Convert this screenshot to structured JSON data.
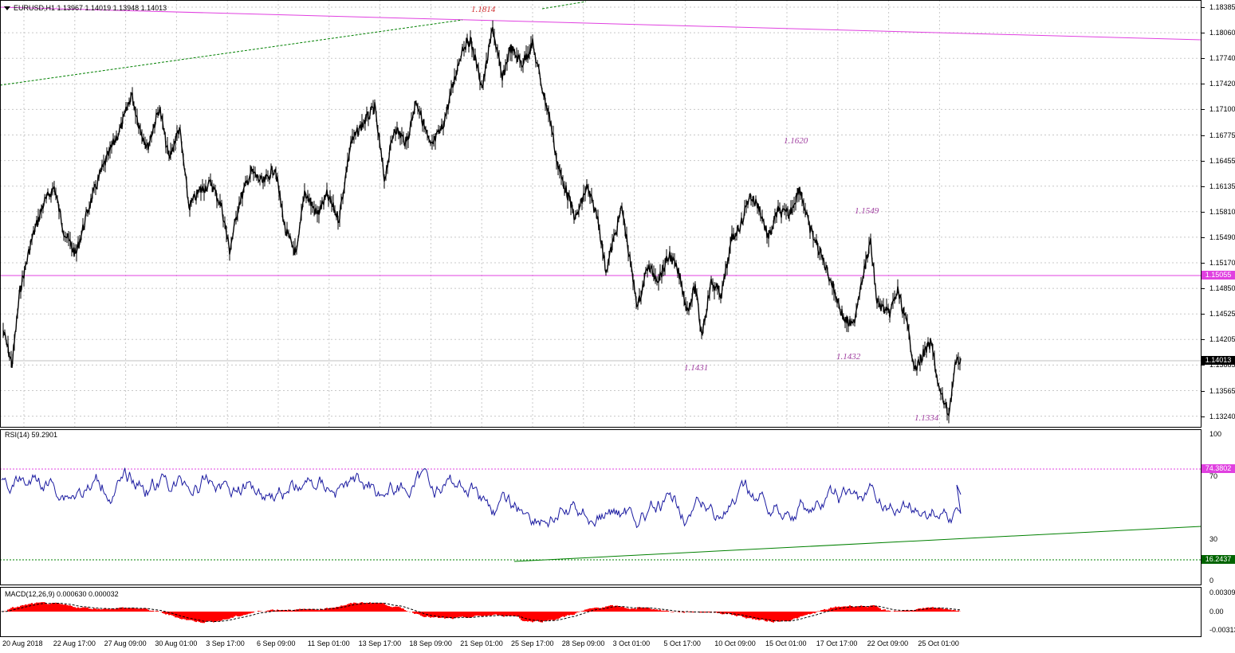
{
  "main": {
    "title": "EURUSD,H1  1.13967 1.14019 1.13948 1.14013",
    "price_labels": [
      "1.18385",
      "1.18060",
      "1.17740",
      "1.17420",
      "1.17100",
      "1.16775",
      "1.16455",
      "1.16135",
      "1.15810",
      "1.15490",
      "1.15170",
      "1.14850",
      "1.14525",
      "1.14205",
      "1.13885",
      "1.13565",
      "1.13240"
    ],
    "hline_tag": "1.15055",
    "current_tag": "1.14013",
    "annotations": {
      "peak": "1.1814",
      "a1620": "1.1620",
      "a1549": "1.1549",
      "a1431": "1.1431",
      "a1432": "1.1432",
      "a1334": "1.1334"
    },
    "colors": {
      "candles": "#000000",
      "magenta": "#e040e0",
      "trend_green": "#008000",
      "peak_red": "#d03030",
      "annotation": "#a040a0"
    }
  },
  "rsi": {
    "title": "RSI(14) 59.2901",
    "labels": [
      "100",
      "70",
      "30",
      "0"
    ],
    "tag_upper": "74.3802",
    "tag_lower": "16.2437",
    "colors": {
      "line": "#1a1aa0",
      "upper": "#e040e0",
      "lower": "#008000"
    }
  },
  "macd": {
    "title": "MACD(12,26,9) 0.000630 0.000032",
    "labels": [
      "0.003091",
      "0.00",
      "-0.003134"
    ],
    "colors": {
      "hist": "#ff0000",
      "signal": "#000000"
    }
  },
  "time_axis": [
    "20 Aug 2018",
    "22 Aug 17:00",
    "27 Aug 09:00",
    "30 Aug 01:00",
    "3 Sep 17:00",
    "6 Sep 09:00",
    "11 Sep 01:00",
    "13 Sep 17:00",
    "18 Sep 09:00",
    "21 Sep 01:00",
    "25 Sep 17:00",
    "28 Sep 09:00",
    "3 Oct 01:00",
    "5 Oct 17:00",
    "10 Oct 09:00",
    "15 Oct 01:00",
    "17 Oct 17:00",
    "22 Oct 09:00",
    "25 Oct 01:00"
  ]
}
